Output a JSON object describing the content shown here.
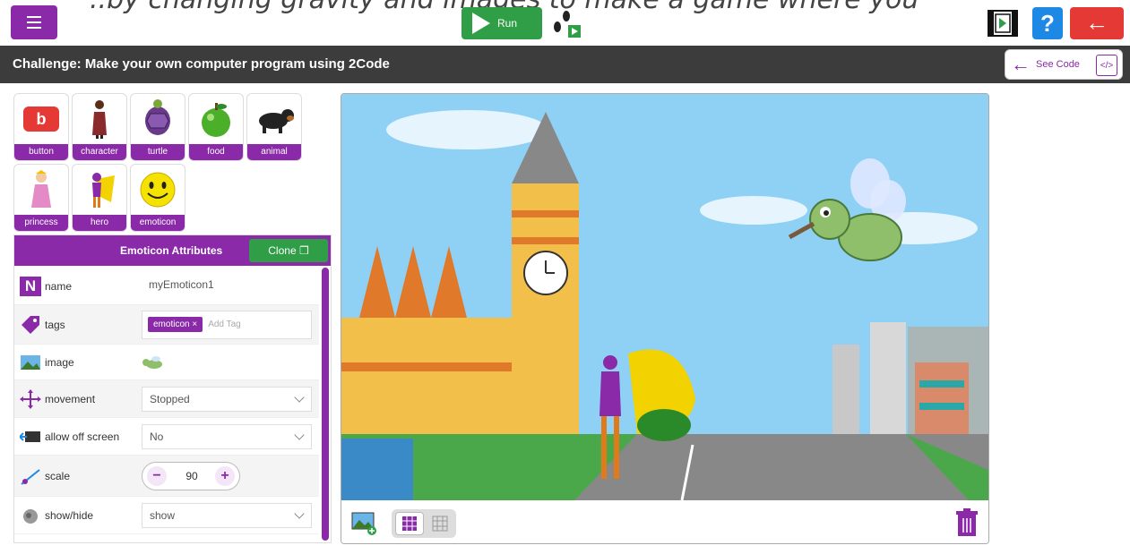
{
  "header": {
    "instruction_partial": "..by changing gravity and images to make a game where you",
    "run_label": "Run",
    "help_label": "?"
  },
  "challenge": {
    "title": "Challenge: Make your own computer program using 2Code",
    "see_code_label": "See Code",
    "code_icon_label": "</>"
  },
  "palette": {
    "items": [
      {
        "label": "button",
        "icon": "button-icon"
      },
      {
        "label": "character",
        "icon": "character-icon"
      },
      {
        "label": "turtle",
        "icon": "turtle-icon"
      },
      {
        "label": "food",
        "icon": "apple-icon"
      },
      {
        "label": "animal",
        "icon": "dog-icon"
      },
      {
        "label": "princess",
        "icon": "princess-icon"
      },
      {
        "label": "hero",
        "icon": "hero-icon"
      },
      {
        "label": "emoticon",
        "icon": "smiley-icon"
      }
    ],
    "button_glyph": "b"
  },
  "attributes": {
    "title": "Emoticon Attributes",
    "clone_label": "Clone",
    "rows": [
      {
        "label": "name",
        "value": "myEmoticon1"
      },
      {
        "label": "tags",
        "tag": "emoticon ×",
        "placeholder": "Add Tag"
      },
      {
        "label": "image"
      },
      {
        "label": "movement",
        "value": "Stopped"
      },
      {
        "label": "allow off screen",
        "value": "No"
      },
      {
        "label": "scale",
        "value": "90"
      },
      {
        "label": "show/hide",
        "value": "show"
      }
    ],
    "name_glyph": "N"
  },
  "colors": {
    "brand_purple": "#8a2aa8",
    "run_green": "#2f9e46",
    "help_blue": "#1e88e5",
    "back_red": "#e53935",
    "challenge_bar": "#3c3c3c"
  }
}
